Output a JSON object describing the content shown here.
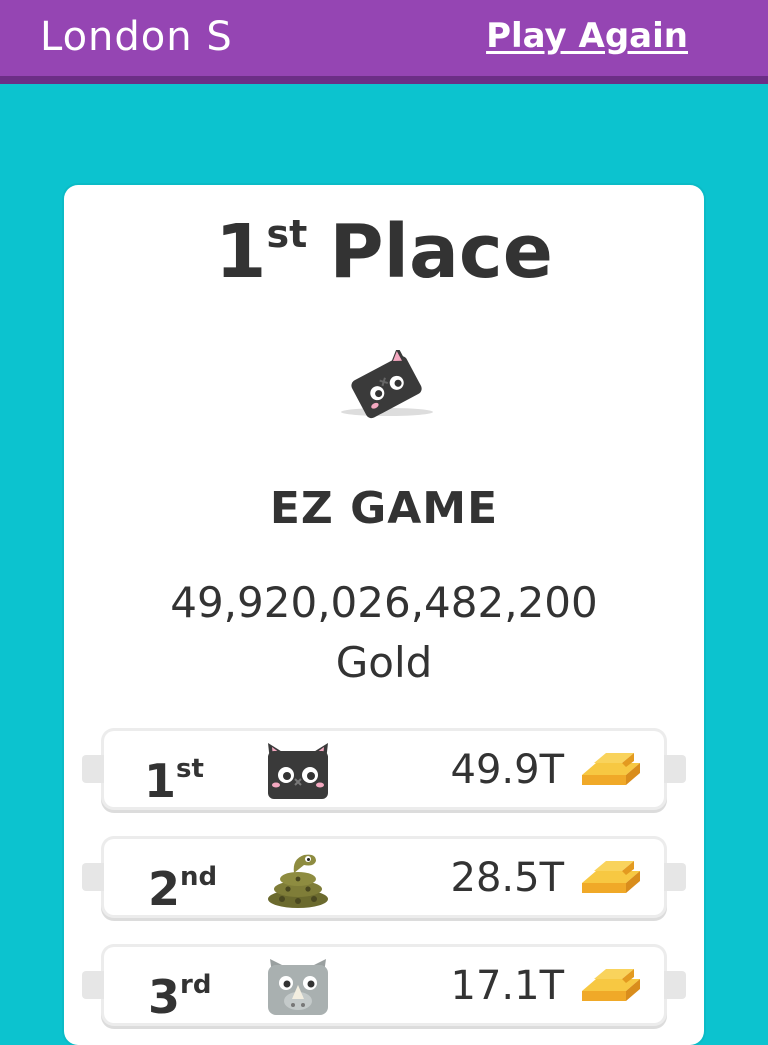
{
  "header": {
    "player_name": "London S",
    "play_again_label": "Play Again"
  },
  "result": {
    "place_number": "1",
    "place_suffix": "st",
    "place_word": "Place",
    "team_name": "EZ GAME",
    "gold_amount": "49,920,026,482,200",
    "gold_unit": "Gold",
    "avatar_icon": "black-cat-block-icon"
  },
  "leaderboard": [
    {
      "rank": "1",
      "suffix": "st",
      "icon": "black-cat-icon",
      "value": "49.9T",
      "gold_icon": "gold-bars-icon"
    },
    {
      "rank": "2",
      "suffix": "nd",
      "icon": "snake-icon",
      "value": "28.5T",
      "gold_icon": "gold-bars-icon"
    },
    {
      "rank": "3",
      "suffix": "rd",
      "icon": "rhino-icon",
      "value": "17.1T",
      "gold_icon": "gold-bars-icon"
    }
  ],
  "colors": {
    "background": "#0cc3cf",
    "header": "#9545b3",
    "header_shadow": "#6c2e86",
    "text": "#333333",
    "gold": "#f5b324"
  }
}
